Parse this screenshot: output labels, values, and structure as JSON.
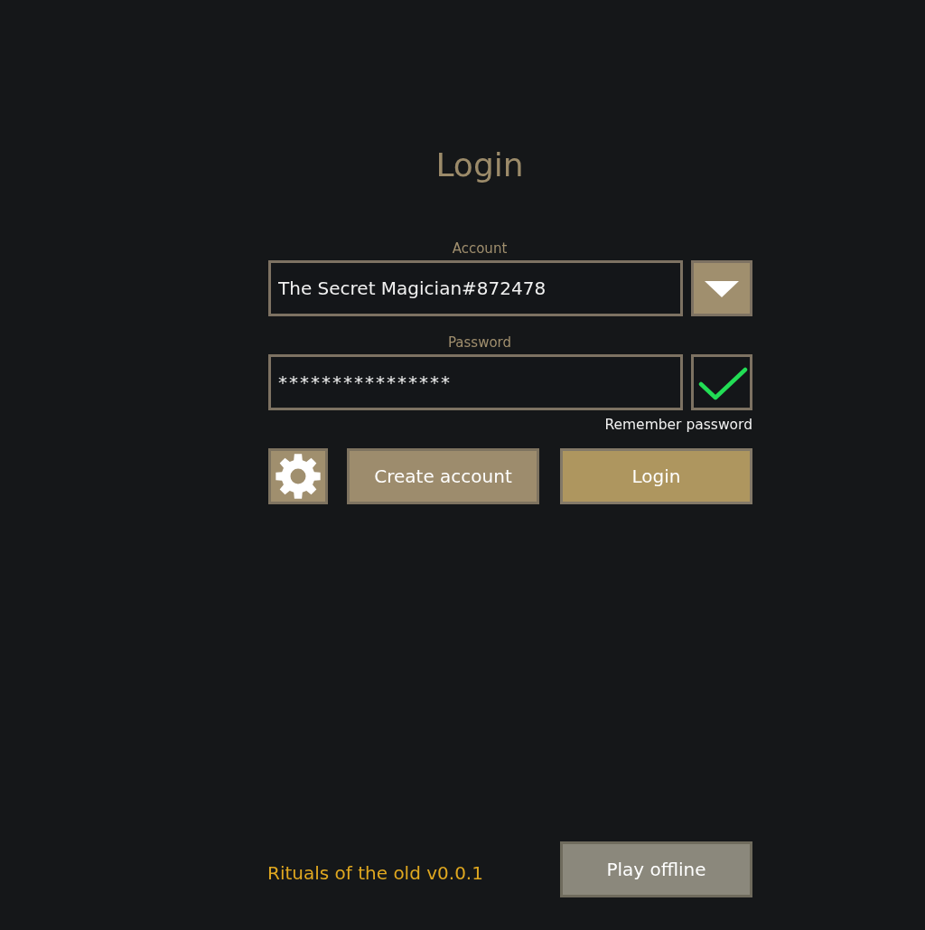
{
  "title": "Login",
  "account": {
    "label": "Account",
    "value": "The Secret Magician#872478"
  },
  "password": {
    "label": "Password",
    "value": "****************",
    "remember": {
      "label": "Remember password",
      "checked": true
    }
  },
  "buttons": [
    {
      "kind": "settings"
    },
    {
      "kind": "secondary",
      "label": "Create account"
    },
    {
      "kind": "primary",
      "label": "Login"
    }
  ],
  "footer": {
    "version": "Rituals of the old v0.0.1",
    "button": "Play offline"
  }
}
